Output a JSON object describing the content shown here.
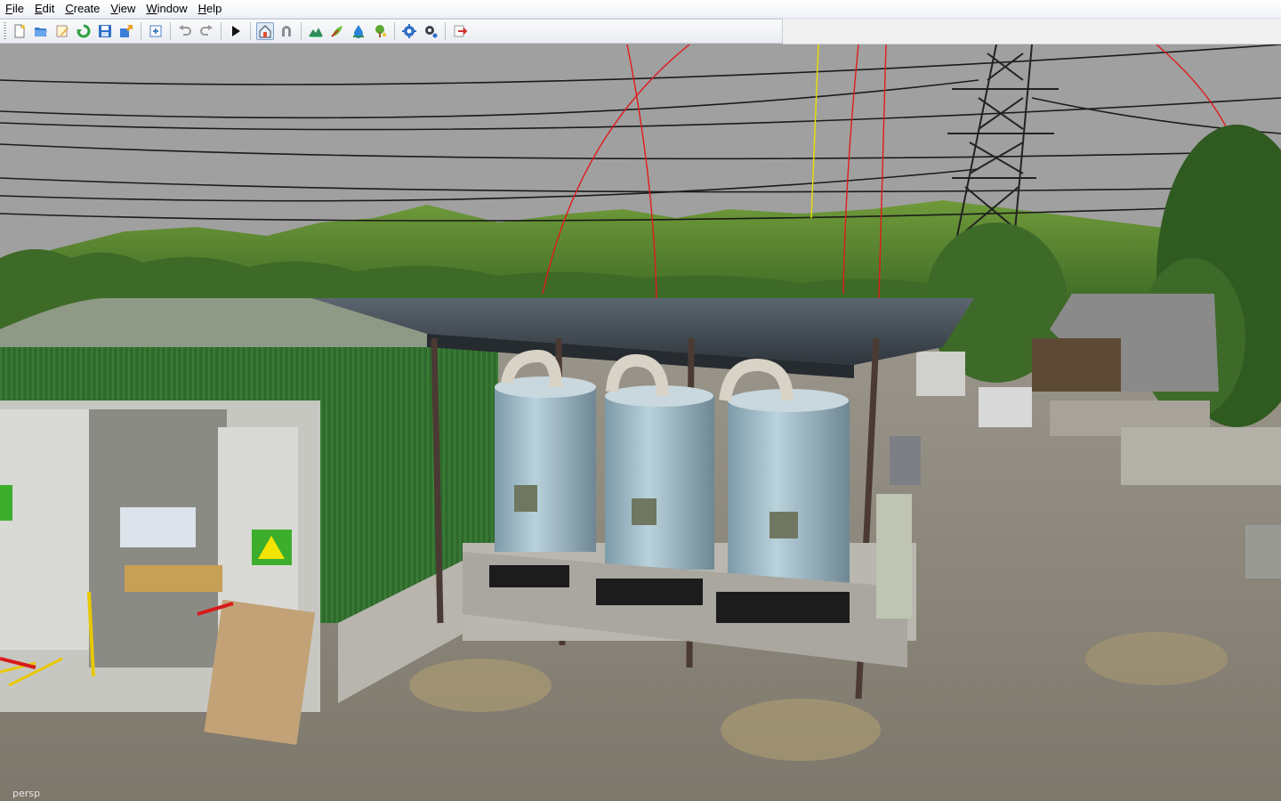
{
  "menu": {
    "items": [
      "File",
      "Edit",
      "Create",
      "View",
      "Window",
      "Help"
    ]
  },
  "toolbar": {
    "buttons": [
      "new-file-icon",
      "open-folder-icon",
      "edit-file-icon",
      "refresh-icon",
      "save-icon",
      "export-icon",
      "import-icon",
      "undo-icon",
      "redo-icon",
      "play-icon",
      "home-select-icon",
      "magnet-icon",
      "terrain-icon",
      "foliage-icon",
      "water-icon",
      "tree-icon",
      "settings-gear-icon",
      "settings-gear-alt-icon",
      "exit-icon"
    ]
  },
  "viewport": {
    "camera_label": "persp",
    "sky_color": "#a0a0a0",
    "ground_color": "#8a8478"
  }
}
